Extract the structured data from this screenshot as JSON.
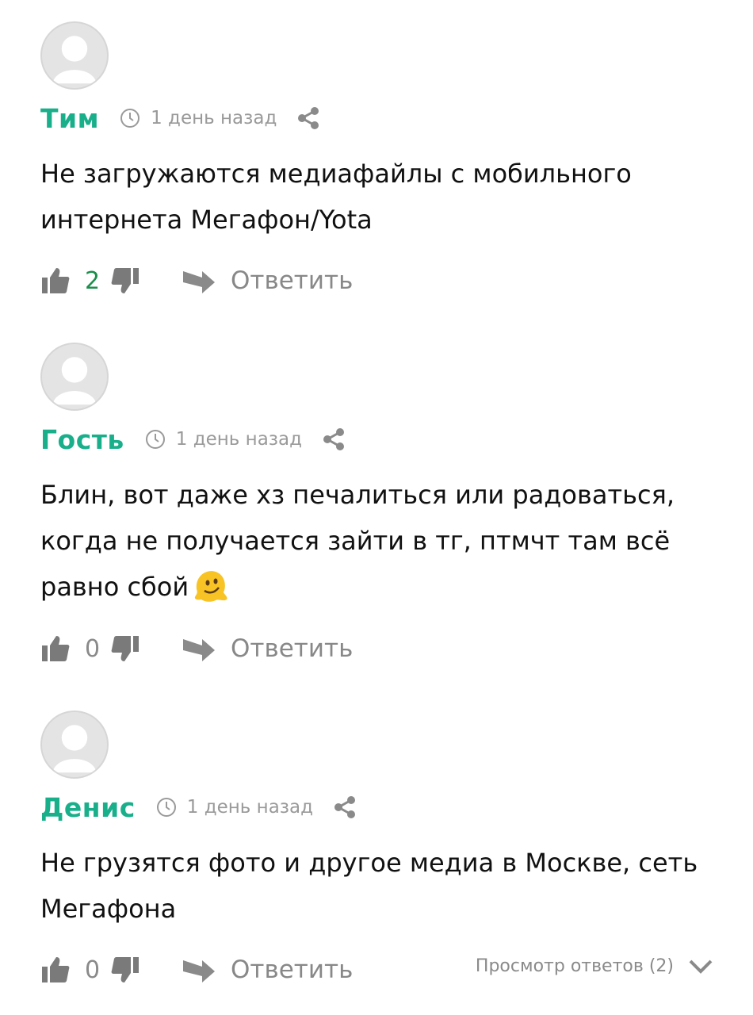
{
  "comments": [
    {
      "author": "Тим",
      "time": "1 день назад",
      "text_lines": [
        "Не загружаются медиафайлы с мобильного",
        "интернета Мегафон/Yota"
      ],
      "likes": "2",
      "reply_label": "Ответить"
    },
    {
      "author": "Гость",
      "time": "1 день назад",
      "text_lines": [
        "Блин, вот даже хз печалиться или радоваться,",
        "когда не получается зайти в тг, птмчт там всё",
        "равно сбой"
      ],
      "emoji": "melting-face-emoji",
      "likes": "0",
      "reply_label": "Ответить"
    },
    {
      "author": "Денис",
      "time": "1 день назад",
      "text_lines": [
        "Не грузятся фото и другое медиа в Москве, сеть",
        "Мегафона"
      ],
      "likes": "0",
      "reply_label": "Ответить",
      "replies_label": "Просмотр ответов (2)"
    }
  ],
  "colors": {
    "author": "#1aaf8b",
    "positive_likes": "#1a8f4a",
    "muted": "#8a8a8a"
  },
  "icons": [
    "avatar-placeholder",
    "clock-icon",
    "share-icon",
    "thumbs-up-icon",
    "thumbs-down-icon",
    "reply-arrow-icon",
    "chevron-down-icon"
  ]
}
